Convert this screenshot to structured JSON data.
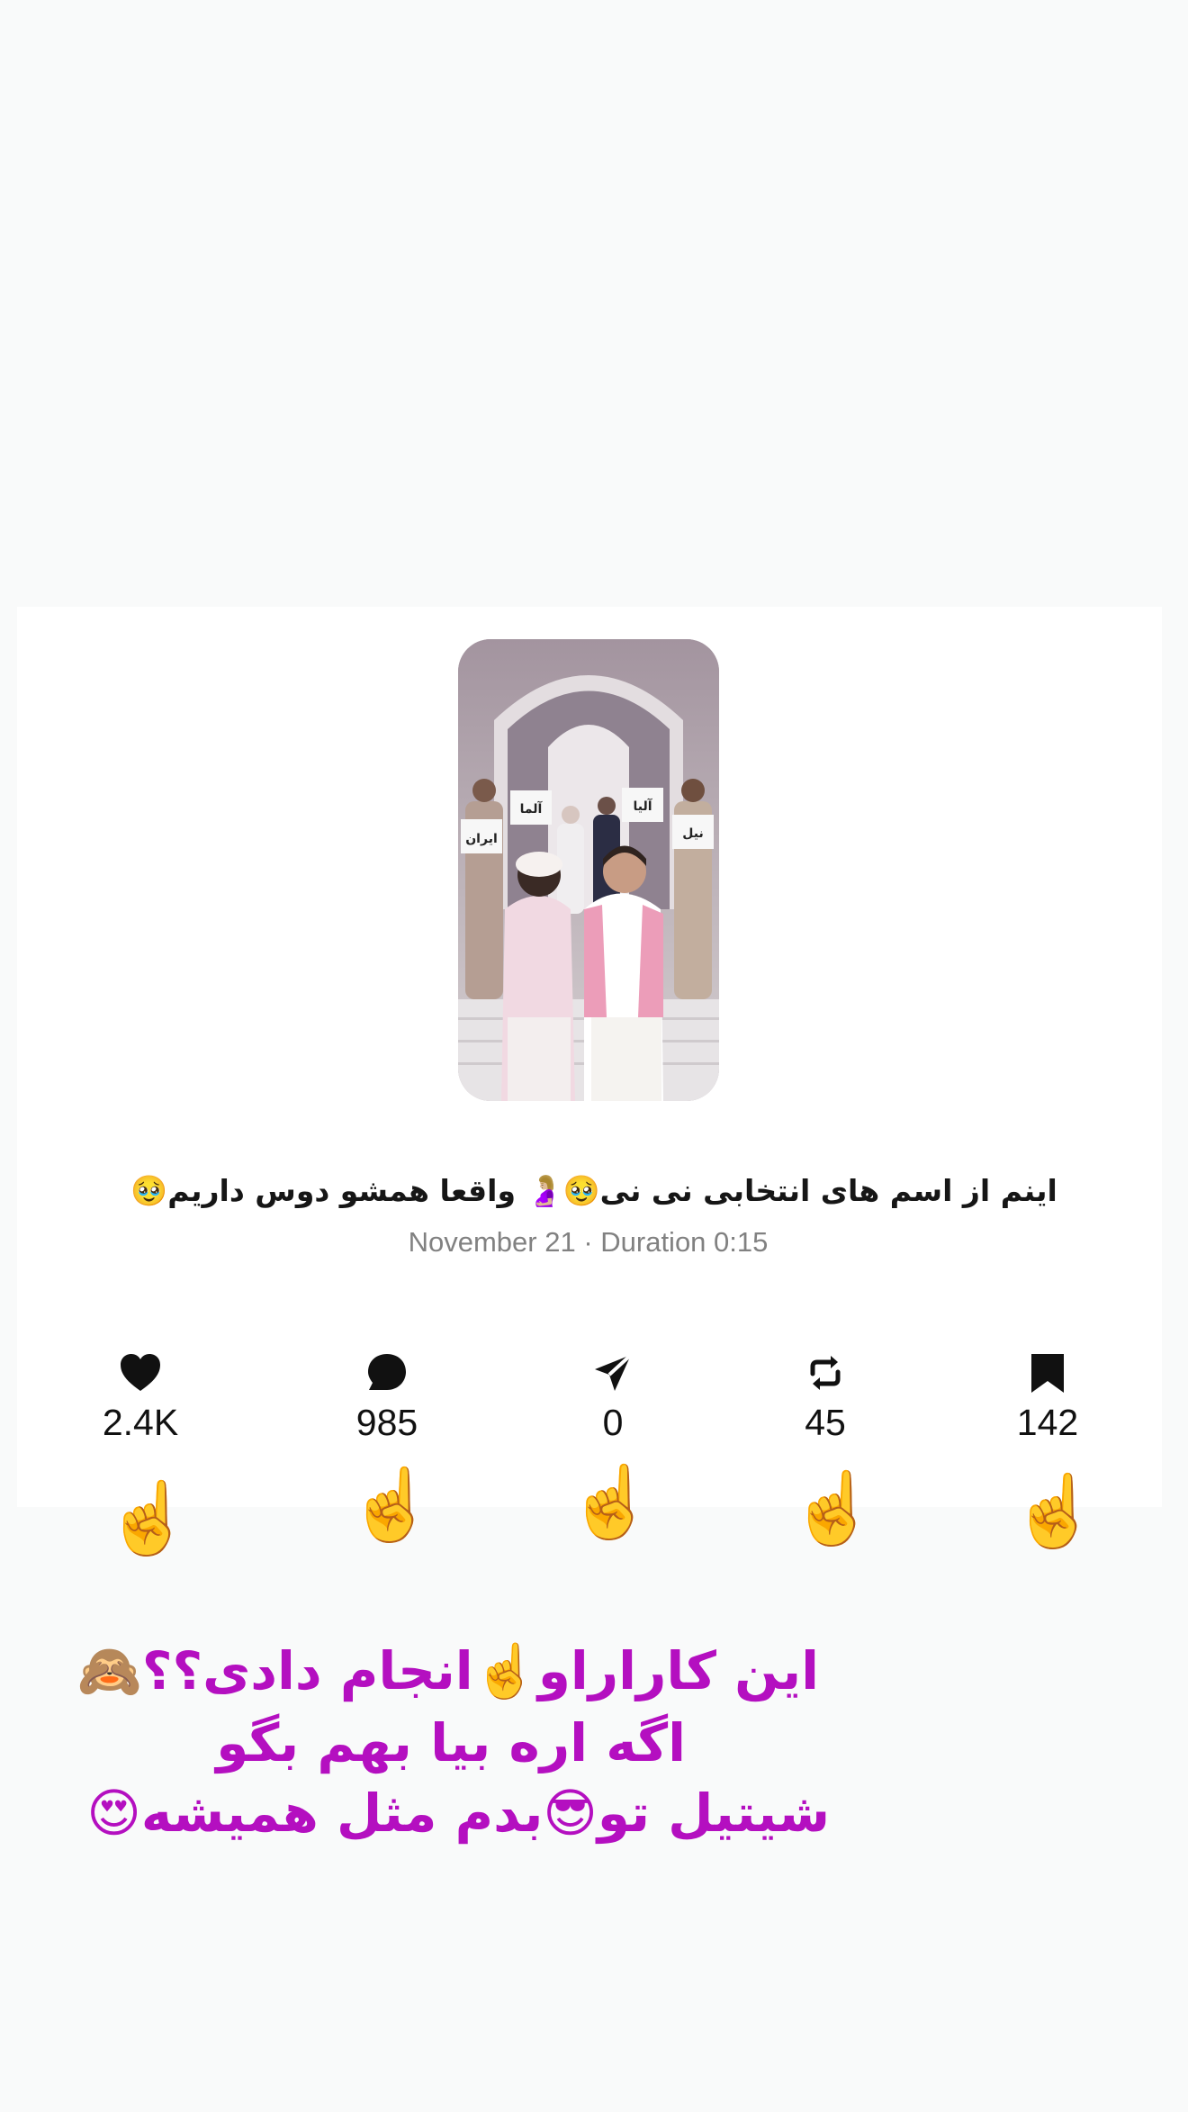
{
  "post": {
    "caption": "اینم از اسم های انتخابی نی نی🥹🤰🏼 واقعا همشو دوس داریم🥹",
    "meta": "November 21 · Duration 0:15",
    "thumbnail_signs": [
      "ایران",
      "آلما",
      "آلیا",
      "نیل"
    ]
  },
  "stats": [
    {
      "icon": "heart-icon",
      "count": "2.4K"
    },
    {
      "icon": "comment-icon",
      "count": "985"
    },
    {
      "icon": "send-icon",
      "count": "0"
    },
    {
      "icon": "repost-icon",
      "count": "45"
    },
    {
      "icon": "bookmark-icon",
      "count": "142"
    }
  ],
  "pointers": {
    "emoji": "☝️"
  },
  "overlay": {
    "lines": [
      "این کاراراو☝️انجام دادی؟؟🙈",
      "اگه اره بیا بهم بگو",
      "شیتیل تو😎بدم مثل همیشه😍"
    ],
    "color": "#b40fc0"
  }
}
